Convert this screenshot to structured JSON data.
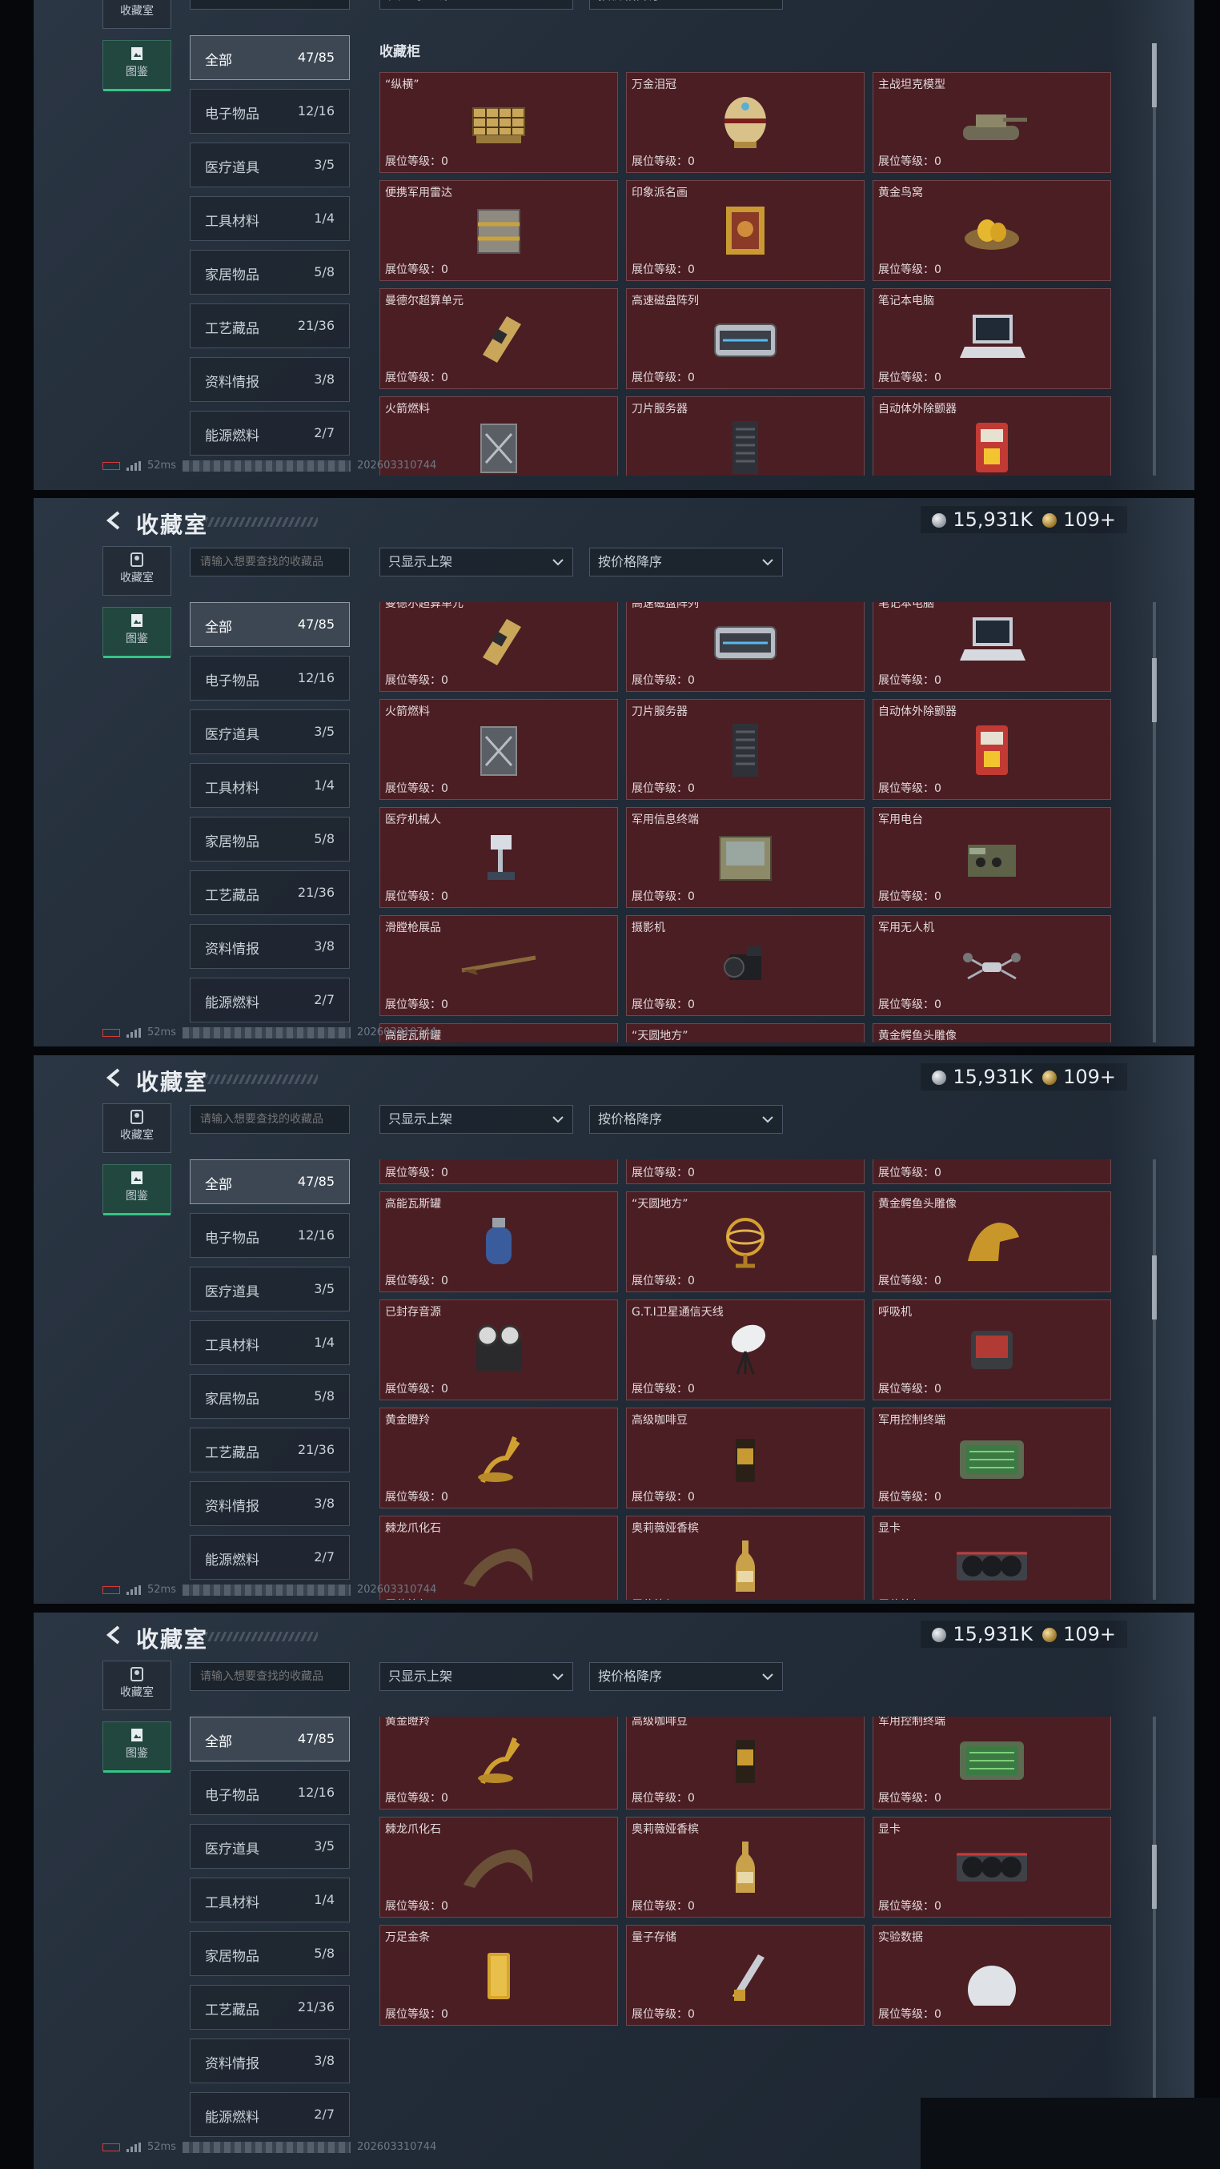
{
  "header": {
    "title": "收藏室",
    "silver": "15,931K",
    "gold": "109+"
  },
  "nav": [
    {
      "label": "收藏室",
      "icon": "trophy-icon"
    },
    {
      "label": "图鉴",
      "icon": "album-icon"
    }
  ],
  "search": {
    "placeholder": "请输入想要查找的收藏品"
  },
  "filters": {
    "shelf": "只显示上架",
    "sort": "按价格降序"
  },
  "section_title": "收藏柜",
  "categories": [
    {
      "label": "全部",
      "count": "47/85"
    },
    {
      "label": "电子物品",
      "count": "12/16"
    },
    {
      "label": "医疗道具",
      "count": "3/5"
    },
    {
      "label": "工具材料",
      "count": "1/4"
    },
    {
      "label": "家居物品",
      "count": "5/8"
    },
    {
      "label": "工艺藏品",
      "count": "21/36"
    },
    {
      "label": "资料情报",
      "count": "3/8"
    },
    {
      "label": "能源燃料",
      "count": "2/7"
    }
  ],
  "level_label": "展位等级：0",
  "items": [
    {
      "name": "“纵横”",
      "icon": "chessboard-icon"
    },
    {
      "name": "万金泪冠",
      "icon": "jeweled-egg-icon"
    },
    {
      "name": "主战坦克模型",
      "icon": "tank-model-icon"
    },
    {
      "name": "便携军用雷达",
      "icon": "radar-case-icon"
    },
    {
      "name": "印象派名画",
      "icon": "painting-icon"
    },
    {
      "name": "黄金鸟窝",
      "icon": "golden-nest-icon"
    },
    {
      "name": "曼德尔超算单元",
      "icon": "compute-unit-icon"
    },
    {
      "name": "高速磁盘阵列",
      "icon": "disk-array-icon"
    },
    {
      "name": "笔记本电脑",
      "icon": "laptop-icon"
    },
    {
      "name": "火箭燃料",
      "icon": "fuel-canister-icon"
    },
    {
      "name": "刀片服务器",
      "icon": "server-icon"
    },
    {
      "name": "自动体外除颤器",
      "icon": "defibrillator-icon"
    },
    {
      "name": "医疗机械人",
      "icon": "medical-robot-icon"
    },
    {
      "name": "军用信息终端",
      "icon": "field-terminal-icon"
    },
    {
      "name": "军用电台",
      "icon": "radio-icon"
    },
    {
      "name": "滑膛枪展品",
      "icon": "musket-icon"
    },
    {
      "name": "摄影机",
      "icon": "camera-icon"
    },
    {
      "name": "军用无人机",
      "icon": "drone-icon"
    },
    {
      "name": "高能瓦斯罐",
      "icon": "gas-tank-icon"
    },
    {
      "name": "“天圆地方”",
      "icon": "armillary-icon"
    },
    {
      "name": "黄金鳄鱼头雕像",
      "icon": "croc-head-icon"
    },
    {
      "name": "已封存音源",
      "icon": "tape-recorder-icon"
    },
    {
      "name": "G.T.I卫星通信天线",
      "icon": "dish-antenna-icon"
    },
    {
      "name": "呼吸机",
      "icon": "ventilator-icon"
    },
    {
      "name": "黄金瞪羚",
      "icon": "golden-gazelle-icon"
    },
    {
      "name": "高级咖啡豆",
      "icon": "coffee-bag-icon"
    },
    {
      "name": "军用控制终端",
      "icon": "control-terminal-icon"
    },
    {
      "name": "棘龙爪化石",
      "icon": "fossil-claw-icon"
    },
    {
      "name": "奥莉薇娅香槟",
      "icon": "champagne-icon"
    },
    {
      "name": "显卡",
      "icon": "gpu-icon"
    },
    {
      "name": "万足金条",
      "icon": "gold-bar-icon"
    },
    {
      "name": "量子存储",
      "icon": "quantum-storage-icon"
    },
    {
      "name": "实验数据",
      "icon": "data-disc-icon"
    }
  ],
  "status": {
    "ping": "52ms",
    "id_suffix": "202603310744"
  },
  "colors": {
    "card_bg": "#4b1e24",
    "active_green": "#35c486",
    "panel_bg": "#242e3a"
  }
}
